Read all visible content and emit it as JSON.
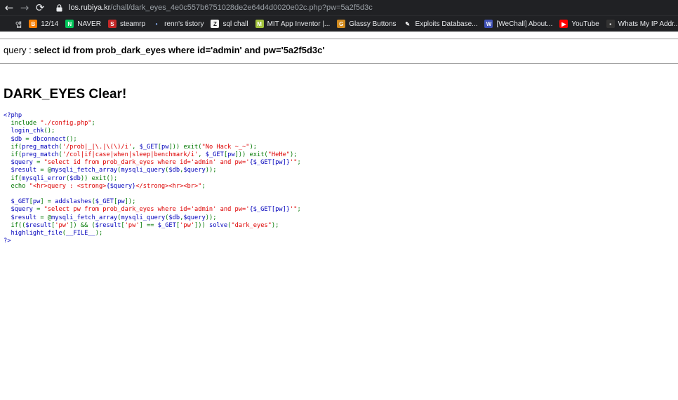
{
  "browser": {
    "url_host": "los.rubiya.kr",
    "url_path": "/chall/dark_eyes_4e0c557b6751028de2e64d4d0020e02c.php?pw=5a2f5d3c"
  },
  "bookmarks": [
    {
      "label": "앱",
      "icon": "apps-icon",
      "color": "#202124",
      "glyph": ""
    },
    {
      "label": "12/14",
      "icon": "blogger-icon",
      "color": "#f57d00",
      "glyph": "B"
    },
    {
      "label": "NAVER",
      "icon": "naver-icon",
      "color": "#03c75a",
      "glyph": "N"
    },
    {
      "label": "steamrp",
      "icon": "steamrp-icon",
      "color": "#c62828",
      "glyph": "S"
    },
    {
      "label": "renn's tistory",
      "icon": "tistory-icon",
      "color": "#202124",
      "glyph": "•"
    },
    {
      "label": "sql chall",
      "icon": "z-icon",
      "color": "#f5f5f5",
      "glyph": "Z"
    },
    {
      "label": "MIT App Inventor |...",
      "icon": "mit-app-inventor-icon",
      "color": "#a0c03c",
      "glyph": "M"
    },
    {
      "label": "Glassy Buttons",
      "icon": "glassy-buttons-icon",
      "color": "#d08a1e",
      "glyph": "G"
    },
    {
      "label": "Exploits Database...",
      "icon": "exploit-db-icon",
      "color": "#202124",
      "glyph": "✎"
    },
    {
      "label": "[WeChall] About...",
      "icon": "wechall-icon",
      "color": "#3f51b5",
      "glyph": "W"
    },
    {
      "label": "YouTube",
      "icon": "youtube-icon",
      "color": "#ff0000",
      "glyph": "▶"
    },
    {
      "label": "Whats My IP Addr...",
      "icon": "whatsmyip-icon",
      "color": "#333333",
      "glyph": "▪"
    }
  ],
  "page": {
    "query_prefix": "query : ",
    "query_sql": "select id from prob_dark_eyes where id='admin' and pw='5a2f5d3c'",
    "clear_title": "DARK_EYES Clear!"
  },
  "source_code": [
    [
      [
        "<?php",
        "c-default"
      ]
    ],
    [
      [
        "  ",
        "c-default"
      ],
      [
        "include ",
        "c-keyword"
      ],
      [
        "\"./config.php\"",
        "c-string"
      ],
      [
        ";",
        "c-keyword"
      ]
    ],
    [
      [
        "  login_chk",
        "c-default"
      ],
      [
        "();",
        "c-keyword"
      ]
    ],
    [
      [
        "  $db ",
        "c-default"
      ],
      [
        "= ",
        "c-keyword"
      ],
      [
        "dbconnect",
        "c-default"
      ],
      [
        "();",
        "c-keyword"
      ]
    ],
    [
      [
        "  ",
        "c-default"
      ],
      [
        "if(",
        "c-keyword"
      ],
      [
        "preg_match",
        "c-default"
      ],
      [
        "(",
        "c-keyword"
      ],
      [
        "'/prob|_|\\.|\\(\\)/i'",
        "c-string"
      ],
      [
        ", ",
        "c-keyword"
      ],
      [
        "$_GET",
        "c-default"
      ],
      [
        "[",
        "c-keyword"
      ],
      [
        "pw",
        "c-default"
      ],
      [
        "])) exit(",
        "c-keyword"
      ],
      [
        "\"No Hack ~_~\"",
        "c-string"
      ],
      [
        ");",
        "c-keyword"
      ]
    ],
    [
      [
        "  ",
        "c-default"
      ],
      [
        "if(",
        "c-keyword"
      ],
      [
        "preg_match",
        "c-default"
      ],
      [
        "(",
        "c-keyword"
      ],
      [
        "'/col|if|case|when|sleep|benchmark/i'",
        "c-string"
      ],
      [
        ", ",
        "c-keyword"
      ],
      [
        "$_GET",
        "c-default"
      ],
      [
        "[",
        "c-keyword"
      ],
      [
        "pw",
        "c-default"
      ],
      [
        "])) exit(",
        "c-keyword"
      ],
      [
        "\"HeHe\"",
        "c-string"
      ],
      [
        ");",
        "c-keyword"
      ]
    ],
    [
      [
        "  $query ",
        "c-default"
      ],
      [
        "= ",
        "c-keyword"
      ],
      [
        "\"select id from prob_dark_eyes where id='admin' and pw='",
        "c-string"
      ],
      [
        "{$_GET[pw]}",
        "c-default"
      ],
      [
        "'\"",
        "c-string"
      ],
      [
        ";",
        "c-keyword"
      ]
    ],
    [
      [
        "  $result ",
        "c-default"
      ],
      [
        "= @",
        "c-keyword"
      ],
      [
        "mysqli_fetch_array",
        "c-default"
      ],
      [
        "(",
        "c-keyword"
      ],
      [
        "mysqli_query",
        "c-default"
      ],
      [
        "(",
        "c-keyword"
      ],
      [
        "$db",
        "c-default"
      ],
      [
        ",",
        "c-keyword"
      ],
      [
        "$query",
        "c-default"
      ],
      [
        "));",
        "c-keyword"
      ]
    ],
    [
      [
        "  ",
        "c-default"
      ],
      [
        "if(",
        "c-keyword"
      ],
      [
        "mysqli_error",
        "c-default"
      ],
      [
        "(",
        "c-keyword"
      ],
      [
        "$db",
        "c-default"
      ],
      [
        ")) exit();",
        "c-keyword"
      ]
    ],
    [
      [
        "  ",
        "c-default"
      ],
      [
        "echo ",
        "c-keyword"
      ],
      [
        "\"<hr>query : <strong>",
        "c-string"
      ],
      [
        "{$query}",
        "c-default"
      ],
      [
        "</strong><hr><br>\"",
        "c-string"
      ],
      [
        ";",
        "c-keyword"
      ]
    ],
    [
      [
        "",
        "c-default"
      ]
    ],
    [
      [
        "  $_GET",
        "c-default"
      ],
      [
        "[",
        "c-keyword"
      ],
      [
        "pw",
        "c-default"
      ],
      [
        "] = ",
        "c-keyword"
      ],
      [
        "addslashes",
        "c-default"
      ],
      [
        "(",
        "c-keyword"
      ],
      [
        "$_GET",
        "c-default"
      ],
      [
        "[",
        "c-keyword"
      ],
      [
        "pw",
        "c-default"
      ],
      [
        "]);",
        "c-keyword"
      ]
    ],
    [
      [
        "  $query ",
        "c-default"
      ],
      [
        "= ",
        "c-keyword"
      ],
      [
        "\"select pw from prob_dark_eyes where id='admin' and pw='",
        "c-string"
      ],
      [
        "{$_GET[pw]}",
        "c-default"
      ],
      [
        "'\"",
        "c-string"
      ],
      [
        ";",
        "c-keyword"
      ]
    ],
    [
      [
        "  $result ",
        "c-default"
      ],
      [
        "= @",
        "c-keyword"
      ],
      [
        "mysqli_fetch_array",
        "c-default"
      ],
      [
        "(",
        "c-keyword"
      ],
      [
        "mysqli_query",
        "c-default"
      ],
      [
        "(",
        "c-keyword"
      ],
      [
        "$db",
        "c-default"
      ],
      [
        ",",
        "c-keyword"
      ],
      [
        "$query",
        "c-default"
      ],
      [
        "));",
        "c-keyword"
      ]
    ],
    [
      [
        "  ",
        "c-default"
      ],
      [
        "if((",
        "c-keyword"
      ],
      [
        "$result",
        "c-default"
      ],
      [
        "[",
        "c-keyword"
      ],
      [
        "'pw'",
        "c-string"
      ],
      [
        "]) && (",
        "c-keyword"
      ],
      [
        "$result",
        "c-default"
      ],
      [
        "[",
        "c-keyword"
      ],
      [
        "'pw'",
        "c-string"
      ],
      [
        "] == ",
        "c-keyword"
      ],
      [
        "$_GET",
        "c-default"
      ],
      [
        "[",
        "c-keyword"
      ],
      [
        "'pw'",
        "c-string"
      ],
      [
        "])) ",
        "c-keyword"
      ],
      [
        "solve",
        "c-default"
      ],
      [
        "(",
        "c-keyword"
      ],
      [
        "\"dark_eyes\"",
        "c-string"
      ],
      [
        ");",
        "c-keyword"
      ]
    ],
    [
      [
        "  highlight_file",
        "c-default"
      ],
      [
        "(",
        "c-keyword"
      ],
      [
        "__FILE__",
        "c-default"
      ],
      [
        ");",
        "c-keyword"
      ]
    ],
    [
      [
        "?>",
        "c-default"
      ]
    ]
  ]
}
